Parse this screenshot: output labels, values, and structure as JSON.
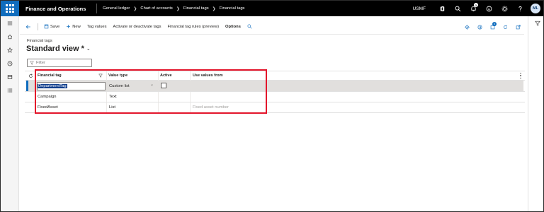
{
  "app": {
    "title": "Finance and Operations",
    "company": "USMF",
    "avatar_initials": "ML",
    "notification_count": "1",
    "accent": "#0f6cbd",
    "topbar_bg": "#000000",
    "highlight_color": "#e3152b"
  },
  "breadcrumbs": [
    "General ledger",
    "Chart of accounts",
    "Financial tags",
    "Financial tags"
  ],
  "toolbar": {
    "save_label": "Save",
    "new_label": "New",
    "tag_values_label": "Tag values",
    "activate_label": "Activate or deactivate tags",
    "rules_label": "Financial tag rules (preview)",
    "options_label": "Options",
    "badge_count": "0"
  },
  "page": {
    "caption": "Financial tags",
    "view_name": "Standard view *",
    "filter_placeholder": "Filter"
  },
  "grid": {
    "columns": [
      "Financial tag",
      "Value type",
      "Active",
      "Use values from"
    ],
    "rows": [
      {
        "tag": "DepartmentTag",
        "value_type": "Custom list",
        "active": false,
        "use_values_from": "",
        "selected": true
      },
      {
        "tag": "Campaign",
        "value_type": "Text",
        "active": null,
        "use_values_from": "",
        "selected": false
      },
      {
        "tag": "FixedAsset",
        "value_type": "List",
        "active": null,
        "use_values_from": "Fixed asset number",
        "selected": false
      }
    ]
  },
  "icons": {
    "topbar": [
      "office-icon",
      "search-icon",
      "notification-bell-icon",
      "smiley-feedback-icon",
      "gear-icon",
      "help-icon"
    ],
    "leftrail": [
      "hamburger-menu-icon",
      "home-icon",
      "star-favorites-icon",
      "clock-recent-icon",
      "workspace-icon",
      "list-modules-icon"
    ],
    "rightrail": [
      "filter-funnel-icon"
    ]
  }
}
